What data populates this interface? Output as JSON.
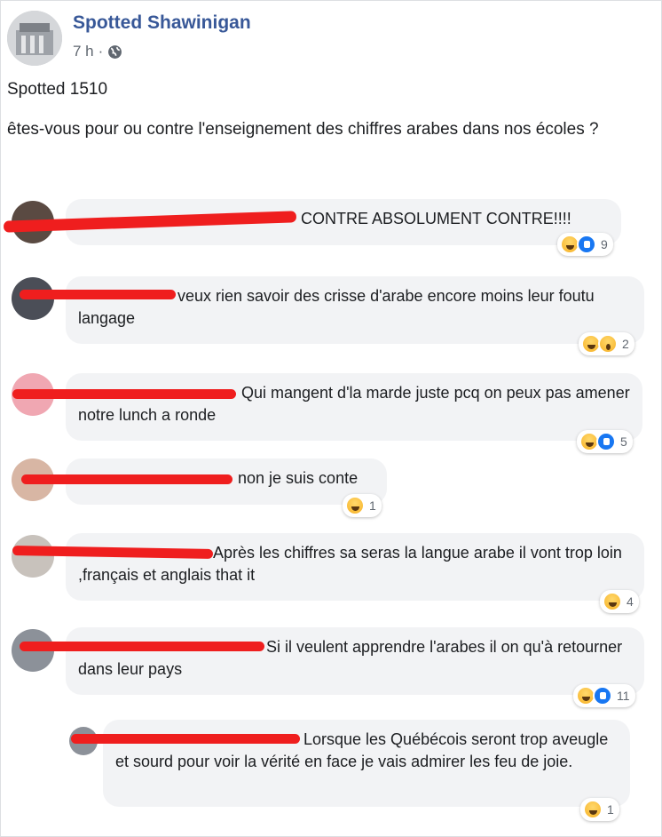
{
  "post": {
    "page_name": "Spotted Shawinigan",
    "time": "7 h",
    "separator": "·",
    "privacy_icon": "globe-icon",
    "title": "Spotted 1510",
    "body": "êtes-vous pour ou contre l'enseignement des chiffres arabes dans nos écoles ?"
  },
  "comments": [
    {
      "text": "CONTRE ABSOLUMENT CONTRE!!!!",
      "reactions": [
        "haha",
        "like"
      ],
      "count": "9"
    },
    {
      "text": "veux rien savoir des crisse d'arabe encore moins leur foutu langage",
      "reactions": [
        "haha",
        "wow"
      ],
      "count": "2"
    },
    {
      "text": "Qui mangent d'la marde juste pcq on peux pas amener notre lunch a ronde",
      "reactions": [
        "haha",
        "like"
      ],
      "count": "5"
    },
    {
      "text": "non je suis conte",
      "reactions": [
        "haha"
      ],
      "count": "1"
    },
    {
      "text": "Après les chiffres sa seras la langue arabe il vont trop loin ,français et anglais that it",
      "reactions": [
        "haha"
      ],
      "count": "4"
    },
    {
      "text": "Si il veulent apprendre l'arabes il on qu'à retourner dans leur pays",
      "reactions": [
        "haha",
        "like"
      ],
      "count": "11"
    },
    {
      "text": "Lorsque les Québécois seront trop aveugle et sourd pour voir la vérité en face je vais admirer les feu de joie.",
      "reactions": [
        "haha"
      ],
      "count": "1"
    }
  ],
  "colors": {
    "link": "#385898",
    "bubble": "#f2f3f5",
    "redaction": "#ef1e1e"
  }
}
